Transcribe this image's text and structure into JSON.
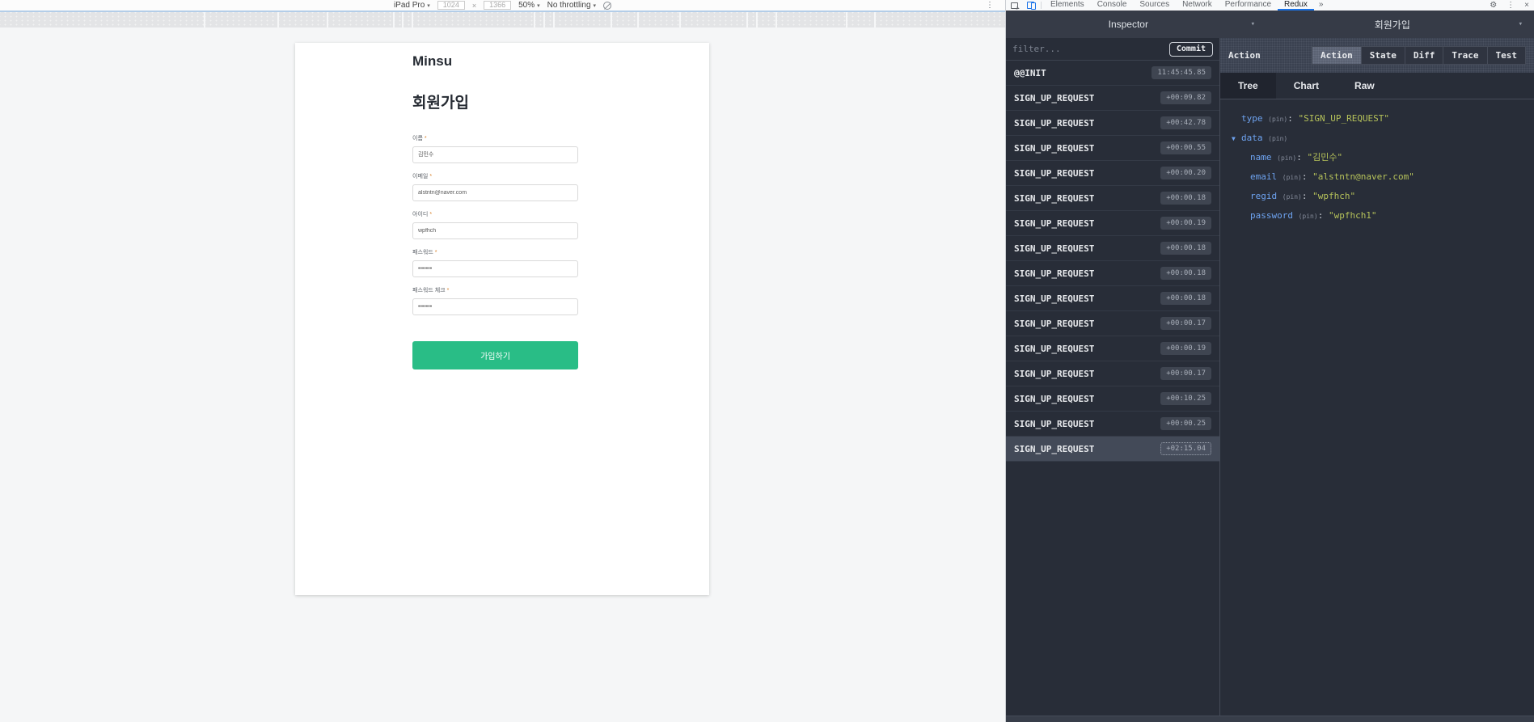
{
  "device_toolbar": {
    "device": "iPad Pro",
    "width": "1024",
    "multiply": "×",
    "height": "1366",
    "zoom": "50%",
    "throttle": "No throttling",
    "kebab": "⋮",
    "caret": "▾"
  },
  "tab_strip": {
    "block_widths": [
      252,
      89,
      59,
      80,
      9,
      10,
      149,
      10,
      10,
      69,
      31,
      50,
      81,
      10,
      22,
      85,
      33,
      180
    ]
  },
  "page": {
    "brand": "Minsu",
    "title": "회원가입",
    "form": {
      "required_mark": "*",
      "fields": [
        {
          "name": "name",
          "label": "이름",
          "value": "김민수"
        },
        {
          "name": "email",
          "label": "이메일",
          "value": "alstntn@naver.com"
        },
        {
          "name": "userid",
          "label": "아이디",
          "value": "wpfhch"
        },
        {
          "name": "password",
          "label": "패스워드",
          "value": "•••••••"
        },
        {
          "name": "password-check",
          "label": "패스워드 체크",
          "value": "•••••••"
        }
      ],
      "submit_label": "가입하기"
    }
  },
  "devtools": {
    "tabs": [
      {
        "label": "Elements",
        "selected": false
      },
      {
        "label": "Console",
        "selected": false
      },
      {
        "label": "Sources",
        "selected": false
      },
      {
        "label": "Network",
        "selected": false
      },
      {
        "label": "Performance",
        "selected": false
      },
      {
        "label": "Redux",
        "selected": true
      }
    ],
    "more_tabs": "»",
    "gear": "⚙",
    "kebab": "⋮",
    "close": "×"
  },
  "redux": {
    "monitor_label": "Inspector",
    "instance_label": "회원가입",
    "caret": "▾",
    "filter_placeholder": "filter...",
    "commit_label": "Commit",
    "actions": [
      {
        "name": "@@INIT",
        "time": "11:45:45.85",
        "selected": false
      },
      {
        "name": "SIGN_UP_REQUEST",
        "time": "+00:09.82",
        "selected": false
      },
      {
        "name": "SIGN_UP_REQUEST",
        "time": "+00:42.78",
        "selected": false
      },
      {
        "name": "SIGN_UP_REQUEST",
        "time": "+00:00.55",
        "selected": false
      },
      {
        "name": "SIGN_UP_REQUEST",
        "time": "+00:00.20",
        "selected": false
      },
      {
        "name": "SIGN_UP_REQUEST",
        "time": "+00:00.18",
        "selected": false
      },
      {
        "name": "SIGN_UP_REQUEST",
        "time": "+00:00.19",
        "selected": false
      },
      {
        "name": "SIGN_UP_REQUEST",
        "time": "+00:00.18",
        "selected": false
      },
      {
        "name": "SIGN_UP_REQUEST",
        "time": "+00:00.18",
        "selected": false
      },
      {
        "name": "SIGN_UP_REQUEST",
        "time": "+00:00.18",
        "selected": false
      },
      {
        "name": "SIGN_UP_REQUEST",
        "time": "+00:00.17",
        "selected": false
      },
      {
        "name": "SIGN_UP_REQUEST",
        "time": "+00:00.19",
        "selected": false
      },
      {
        "name": "SIGN_UP_REQUEST",
        "time": "+00:00.17",
        "selected": false
      },
      {
        "name": "SIGN_UP_REQUEST",
        "time": "+00:10.25",
        "selected": false
      },
      {
        "name": "SIGN_UP_REQUEST",
        "time": "+00:00.25",
        "selected": false
      },
      {
        "name": "SIGN_UP_REQUEST",
        "time": "+02:15.04",
        "selected": true
      }
    ],
    "detail": {
      "header_label": "Action",
      "tabs": [
        {
          "label": "Action",
          "selected": true
        },
        {
          "label": "State",
          "selected": false
        },
        {
          "label": "Diff",
          "selected": false
        },
        {
          "label": "Trace",
          "selected": false
        },
        {
          "label": "Test",
          "selected": false
        }
      ],
      "view_tabs": [
        {
          "label": "Tree",
          "selected": true
        },
        {
          "label": "Chart",
          "selected": false
        },
        {
          "label": "Raw",
          "selected": false
        }
      ],
      "tree": [
        {
          "key": "type",
          "pin": "(pin)",
          "colon": ": ",
          "value": "\"SIGN_UP_REQUEST\"",
          "arrow": "",
          "indent": 0
        },
        {
          "key": "data",
          "pin": "(pin)",
          "colon": "",
          "value": "",
          "arrow": "▼",
          "indent": 0
        },
        {
          "key": "name",
          "pin": "(pin)",
          "colon": ": ",
          "value": "\"김민수\"",
          "arrow": "",
          "indent": 1
        },
        {
          "key": "email",
          "pin": "(pin)",
          "colon": ": ",
          "value": "\"alstntn@naver.com\"",
          "arrow": "",
          "indent": 1
        },
        {
          "key": "regid",
          "pin": "(pin)",
          "colon": ": ",
          "value": "\"wpfhch\"",
          "arrow": "",
          "indent": 1
        },
        {
          "key": "password",
          "pin": "(pin)",
          "colon": ": ",
          "value": "\"wpfhch1\"",
          "arrow": "",
          "indent": 1
        }
      ]
    }
  },
  "colors": {
    "accent_blue": "#1a73e8",
    "panel_dark": "#282d38",
    "button_green": "#29bd86",
    "tree_key": "#6ea3f0",
    "tree_value": "#b6c25a"
  }
}
